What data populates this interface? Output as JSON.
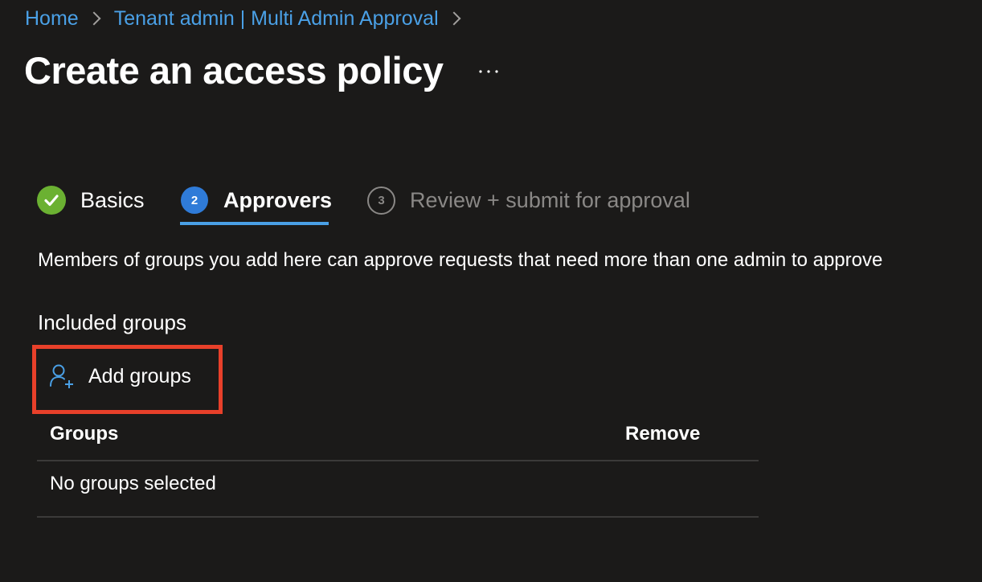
{
  "breadcrumb": {
    "items": [
      "Home",
      "Tenant admin | Multi Admin Approval"
    ]
  },
  "page": {
    "title": "Create an access policy",
    "more_label": "···"
  },
  "wizard": {
    "steps": [
      {
        "label": "Basics",
        "state": "completed",
        "icon": "check-circle-icon"
      },
      {
        "label": "Approvers",
        "number": "2",
        "state": "current"
      },
      {
        "label": "Review + submit for approval",
        "number": "3",
        "state": "upcoming"
      }
    ]
  },
  "approvers": {
    "description": "Members of groups you add here can approve requests that need more than one admin to approve",
    "section_heading": "Included groups",
    "add_button_label": "Add groups",
    "add_button_icon": "add-person-icon",
    "table": {
      "columns": [
        "Groups",
        "Remove"
      ],
      "empty_text": "No groups selected"
    }
  },
  "colors": {
    "background": "#1b1a19",
    "link": "#4aa0e6",
    "accent": "#2f7bd8",
    "success": "#6bb132",
    "highlight": "#e8402a"
  }
}
